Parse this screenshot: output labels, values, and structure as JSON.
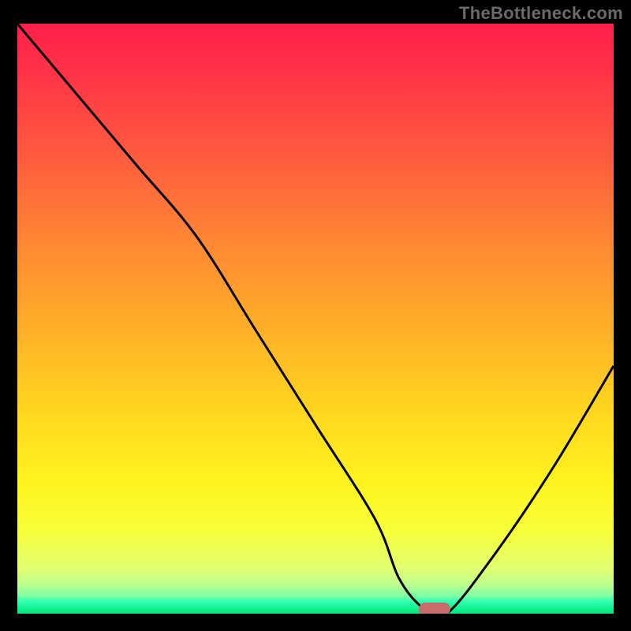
{
  "watermark": "TheBottleneck.com",
  "colors": {
    "frame": "#000000",
    "curve": "#000000",
    "marker": "#c86b6b",
    "gradient_top": "#ff1f4a",
    "gradient_bottom": "#00e676"
  },
  "chart_data": {
    "type": "line",
    "title": "",
    "xlabel": "",
    "ylabel": "",
    "xlim": [
      0,
      100
    ],
    "ylim": [
      0,
      100
    ],
    "x": [
      0,
      10,
      20,
      30,
      40,
      50,
      60,
      64,
      68,
      72,
      80,
      90,
      100
    ],
    "values": [
      100,
      88,
      76,
      64,
      48,
      32,
      16,
      6,
      1,
      0,
      10,
      25,
      42
    ],
    "marker": {
      "x": 70,
      "y": 0
    },
    "grid": false,
    "legend": false
  }
}
